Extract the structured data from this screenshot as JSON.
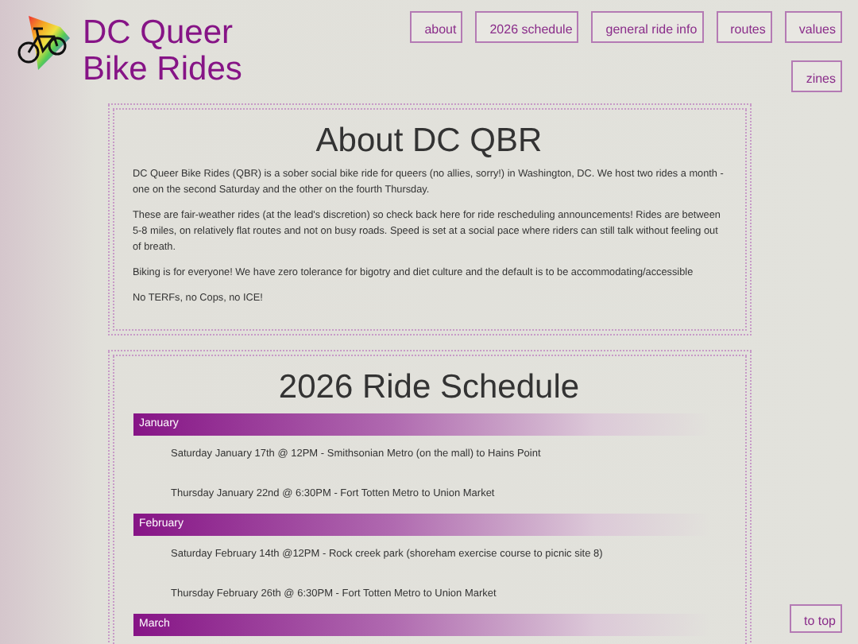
{
  "site": {
    "title": "DC Queer Bike Rides"
  },
  "nav": [
    {
      "label": "about"
    },
    {
      "label": "2026 schedule"
    },
    {
      "label": "general ride info"
    },
    {
      "label": "routes"
    },
    {
      "label": "values"
    },
    {
      "label": "zines"
    }
  ],
  "about": {
    "heading": "About DC QBR",
    "paragraphs": [
      "DC Queer Bike Rides (QBR) is a sober social bike ride for queers (no allies, sorry!) in Washington, DC. We host two rides a month - one on the second Saturday and the other on the fourth Thursday.",
      "These are fair-weather rides (at the lead's discretion) so check back here for ride rescheduling announcements! Rides are between 5-8 miles, on relatively flat routes and not on busy roads. Speed is set at a social pace where riders can still talk without feeling out of breath.",
      "Biking is for everyone! We have zero tolerance for bigotry and diet culture and the default is to be accommodating/accessible",
      "No TERFs, no Cops, no ICE!"
    ]
  },
  "schedule": {
    "heading": "2026 Ride Schedule",
    "months": [
      {
        "name": "January",
        "rides": [
          "Saturday January 17th @ 12PM - Smithsonian Metro (on the mall) to Hains Point",
          "Thursday January 22nd @ 6:30PM - Fort Totten Metro to Union Market"
        ]
      },
      {
        "name": "February",
        "rides": [
          "Saturday February 14th @12PM - Rock creek park (shoreham exercise course to picnic site 8)",
          "Thursday February 26th @ 6:30PM - Fort Totten Metro to Union Market"
        ]
      },
      {
        "name": "March"
      }
    ]
  },
  "to_top": {
    "label": "to top"
  }
}
